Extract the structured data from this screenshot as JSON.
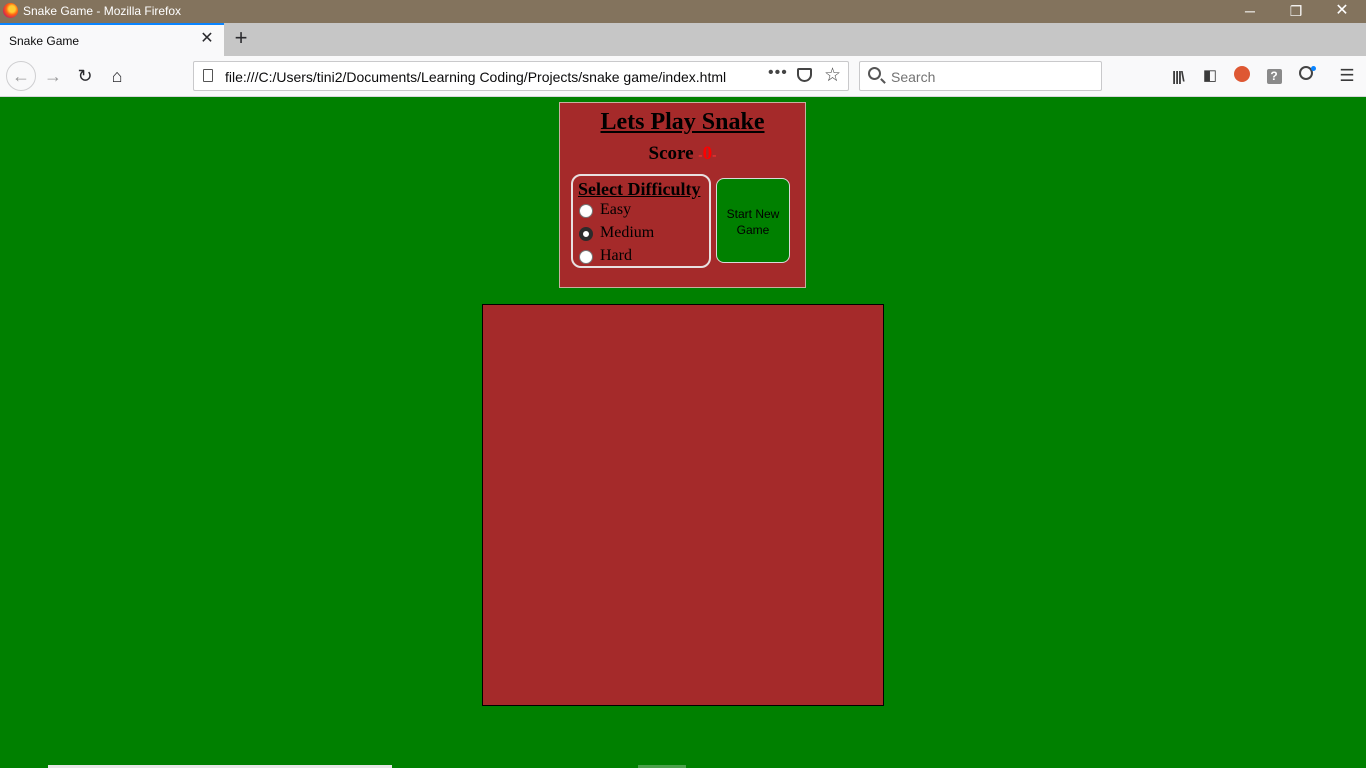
{
  "window": {
    "title": "Snake Game - Mozilla Firefox",
    "minimize_icon": "─",
    "maximize_icon": "❐",
    "close_icon": "✕"
  },
  "tabs": [
    {
      "title": "Snake Game",
      "close_icon": "✕"
    }
  ],
  "new_tab_icon": "+",
  "navbar": {
    "back_icon": "←",
    "forward_icon": "→",
    "reload_icon": "↻",
    "home_icon": "⌂",
    "url": "file:///C:/Users/tini2/Documents/Learning Coding/Projects/snake game/index.html",
    "page_actions_icon": "•••",
    "bookmark_icon": "☆",
    "search_placeholder": "Search",
    "library_icon": "|||\\",
    "sidebar_icon": "◧",
    "help_icon": "?",
    "menu_icon": "☰"
  },
  "game": {
    "title": "Lets Play Snake",
    "score_label": "Score",
    "score_value": "0",
    "difficulty_title": "Select Difficulty",
    "difficulties": [
      {
        "label": "Easy",
        "checked": false
      },
      {
        "label": "Medium",
        "checked": true
      },
      {
        "label": "Hard",
        "checked": false
      }
    ],
    "start_button": "Start New Game"
  },
  "colors": {
    "page_background": "#008000",
    "panel_background": "#a52a2a",
    "score_color": "#ff0000"
  }
}
